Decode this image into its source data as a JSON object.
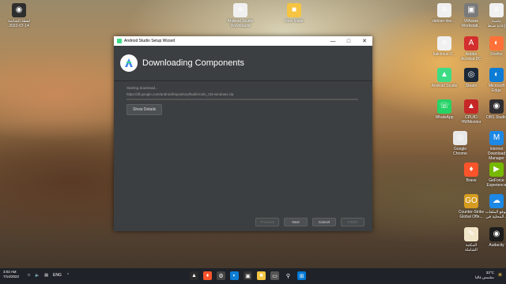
{
  "window": {
    "title": "Android Studio Setup Wizard",
    "heading": "Downloading Components",
    "status": "Starting download...",
    "url": "https://dl.google.com/android/repository/build-tools_r33-windows.zip",
    "progress": 0,
    "show_details": "Show Details",
    "buttons": {
      "previous": "Previous",
      "next": "Next",
      "cancel": "Cancel",
      "finish": "Finish"
    }
  },
  "desktop_icons": [
    {
      "label": "لقطة الشاشة\n2022-07-14",
      "glyph": "◉",
      "color": "#2e2e2e"
    },
    {
      "label": "Android Studio\nDownloads",
      "glyph": "≡",
      "color": "#f0f0f0"
    },
    {
      "label": "New folder",
      "glyph": "■",
      "color": "#f5c542"
    },
    {
      "label": "debian-live-...",
      "glyph": "≡",
      "color": "#f0f0f0"
    },
    {
      "label": "VMware\nWorkstati...",
      "glyph": "▣",
      "color": "#7a7a7a"
    },
    {
      "label": "جلسة\nإعادة ضبط",
      "glyph": "≡",
      "color": "#f0f0f0"
    },
    {
      "label": "kali-linux-2...",
      "glyph": "≡",
      "color": "#f0f0f0"
    },
    {
      "label": "Adobe\nAcrobat DC",
      "glyph": "A",
      "color": "#d32f2f"
    },
    {
      "label": "Firefox",
      "glyph": "◐",
      "color": "#ff7139"
    },
    {
      "label": "Android Studio",
      "glyph": "▲",
      "color": "#3ddc84"
    },
    {
      "label": "Steam",
      "glyph": "◎",
      "color": "#1b2838"
    },
    {
      "label": "Microsoft\nEdge",
      "glyph": "◐",
      "color": "#0c7cd5"
    },
    {
      "label": "WhatsApp",
      "glyph": "☏",
      "color": "#25d366"
    },
    {
      "label": "CPUID\nHWMonitor",
      "glyph": "▲",
      "color": "#c62828"
    },
    {
      "label": "OBS Studio",
      "glyph": "◉",
      "color": "#302e31"
    },
    {
      "label": "Google\nChrome",
      "glyph": "◎",
      "color": "#e8e8e8"
    },
    {
      "label": "Internet\nDownload\nManager",
      "glyph": "M",
      "color": "#1e88e5"
    },
    {
      "label": "Brave",
      "glyph": "♦",
      "color": "#fb542b"
    },
    {
      "label": "GeForce\nExperience",
      "glyph": "▶",
      "color": "#76b900"
    },
    {
      "label": "Counter-Strike\nGlobal Offe...",
      "glyph": "GO",
      "color": "#d69c1f"
    },
    {
      "label": "موقع الملفات\nالمحلية في...",
      "glyph": "☁",
      "color": "#1e88e5"
    },
    {
      "label": "المكتبة\nالشاملة",
      "glyph": "✎",
      "color": "#f2e6c8"
    },
    {
      "label": "Audacity",
      "glyph": "◉",
      "color": "#1c1c1c"
    }
  ],
  "taskbar": {
    "time": "3:02 AM",
    "date": "7/14/2022",
    "lang": "ENG",
    "temp": "33°C",
    "weather": "مشمس غالبا"
  }
}
